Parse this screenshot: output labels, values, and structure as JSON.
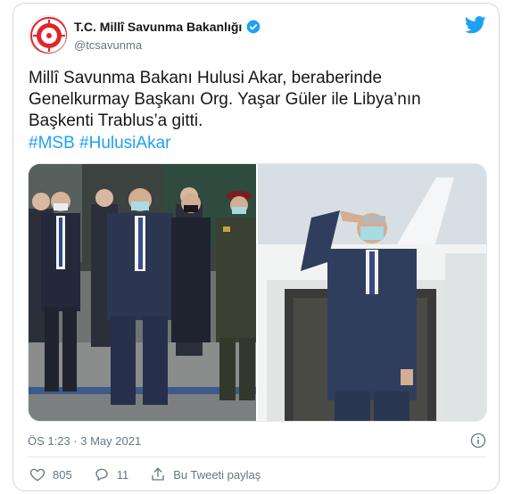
{
  "account": {
    "display_name": "T.C. Millî Savunma Bakanlığı",
    "handle": "@tcsavunma",
    "verified": true,
    "avatar_icon": "msb-emblem-icon"
  },
  "tweet": {
    "text_lines": [
      "Millî Savunma Bakanı Hulusi Akar, beraberinde",
      "Genelkurmay Başkanı Org. Yaşar Güler ile Libya’nın",
      "Başkenti Trablus’a gitti."
    ],
    "hashtags": [
      "#MSB",
      "#HulusiAkar"
    ],
    "timestamp": "ÖS 1:23 · 3 May 2021"
  },
  "actions": {
    "likes": "805",
    "replies": "11",
    "share_label": "Bu Tweeti paylaş"
  },
  "colors": {
    "twitter_blue": "#1da1f2",
    "like_red": "#e0245e",
    "muted": "#657786"
  }
}
